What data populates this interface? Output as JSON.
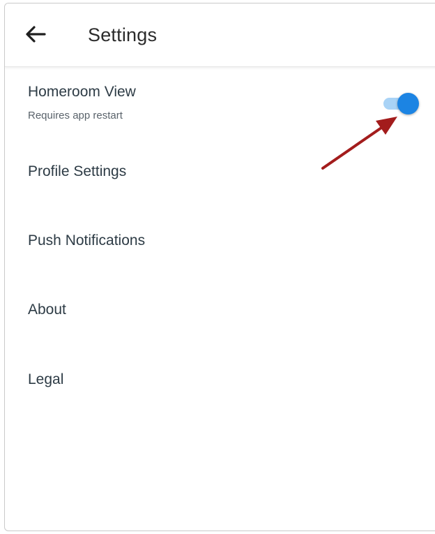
{
  "header": {
    "title": "Settings",
    "back_icon": "arrow-left-icon"
  },
  "settings": {
    "homeroom": {
      "label": "Homeroom View",
      "subtitle": "Requires app restart",
      "toggle_on": true
    },
    "profile": {
      "label": "Profile Settings"
    },
    "push": {
      "label": "Push Notifications"
    },
    "about": {
      "label": "About"
    },
    "legal": {
      "label": "Legal"
    }
  },
  "colors": {
    "toggle_thumb": "#1c84e3",
    "toggle_track": "#a9d3f6",
    "annotation_arrow": "#a31c1c"
  }
}
